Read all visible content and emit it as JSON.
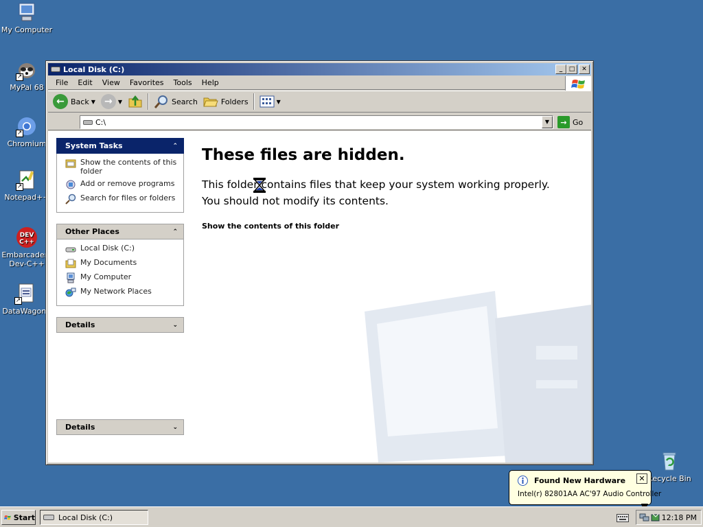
{
  "desktop": {
    "icons": [
      {
        "label": "My Computer"
      },
      {
        "label": "MyPal 68"
      },
      {
        "label": "Chromium"
      },
      {
        "label": "Notepad++"
      },
      {
        "label": "Embarcadero Dev-C++"
      },
      {
        "label": "DataWagon."
      },
      {
        "label": "Recycle Bin"
      }
    ]
  },
  "window": {
    "title": "Local Disk (C:)",
    "menu": [
      "File",
      "Edit",
      "View",
      "Favorites",
      "Tools",
      "Help"
    ],
    "toolbar": {
      "back": "Back",
      "search": "Search",
      "folders": "Folders"
    },
    "address": {
      "value": "C:\\",
      "go": "Go"
    },
    "left_pane": {
      "system_tasks": {
        "title": "System Tasks",
        "items": [
          "Show the contents of this folder",
          "Add or remove programs",
          "Search for files or folders"
        ]
      },
      "other_places": {
        "title": "Other Places",
        "items": [
          "Local Disk (C:)",
          "My Documents",
          "My Computer",
          "My Network Places"
        ]
      },
      "details1": {
        "title": "Details"
      },
      "details2": {
        "title": "Details"
      }
    },
    "main": {
      "heading": "These files are hidden.",
      "line1": "This folder contains files that keep your system working properly.",
      "line2": "You should not modify its contents.",
      "link": "Show the contents of this folder"
    }
  },
  "balloon": {
    "title": "Found New Hardware",
    "message": "Intel(r) 82801AA AC'97 Audio Controller"
  },
  "taskbar": {
    "start": "Start",
    "task": "Local Disk (C:)",
    "clock": "12:18 PM"
  }
}
